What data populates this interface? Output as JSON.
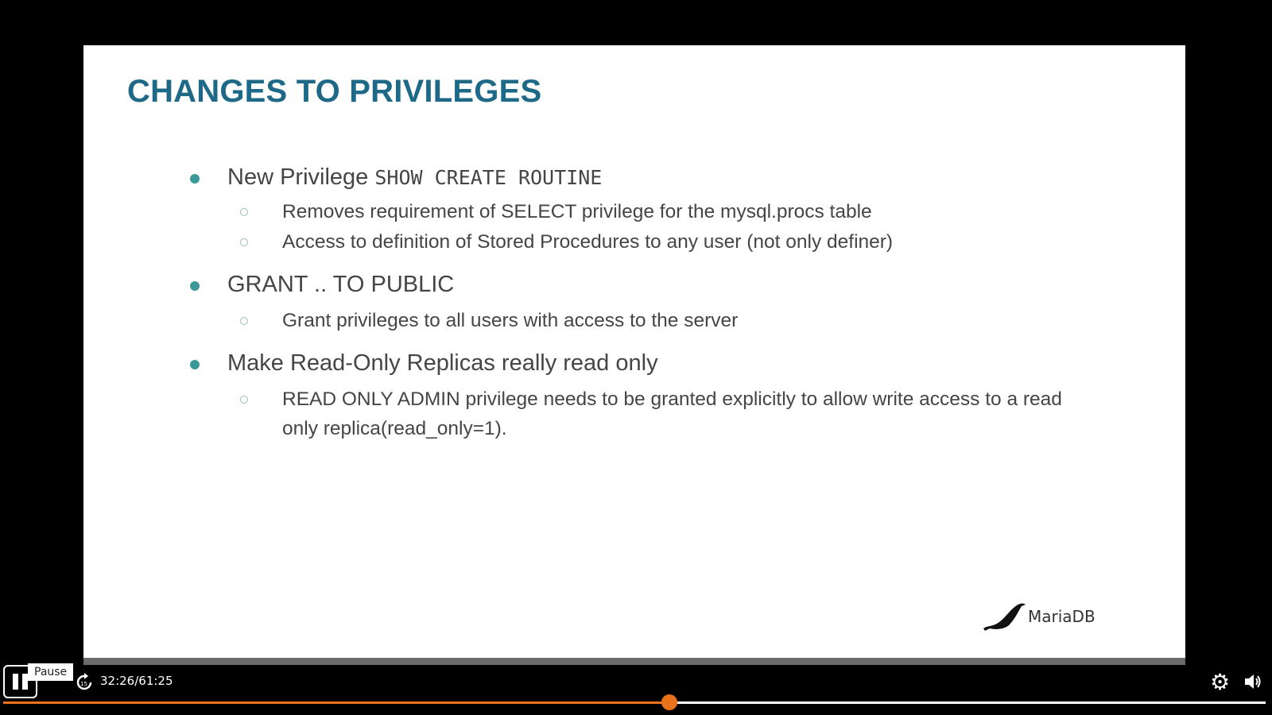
{
  "slide": {
    "title": "CHANGES TO PRIVILEGES",
    "bullets": [
      {
        "text": "New Privilege ",
        "code": "SHOW CREATE ROUTINE",
        "sub": [
          "Removes requirement of SELECT privilege for the mysql.procs table",
          "Access to definition of Stored Procedures to any user (not only definer)"
        ]
      },
      {
        "text": "GRANT .. TO PUBLIC",
        "sub": [
          "Grant privileges to all users with access to the server"
        ]
      },
      {
        "text": "Make Read-Only Replicas really read only",
        "sub": [
          "READ ONLY ADMIN privilege needs to be granted explicitly to allow write access to a read only replica(read_only=1)."
        ]
      }
    ],
    "logo": "MariaDB"
  },
  "player": {
    "tooltip": "Pause",
    "time": "32:26/61:25",
    "progress": 0.528,
    "accent": "#e8731a",
    "icons": [
      "pause-icon",
      "skip-forward-15-icon",
      "gear-icon",
      "volume-icon"
    ]
  }
}
